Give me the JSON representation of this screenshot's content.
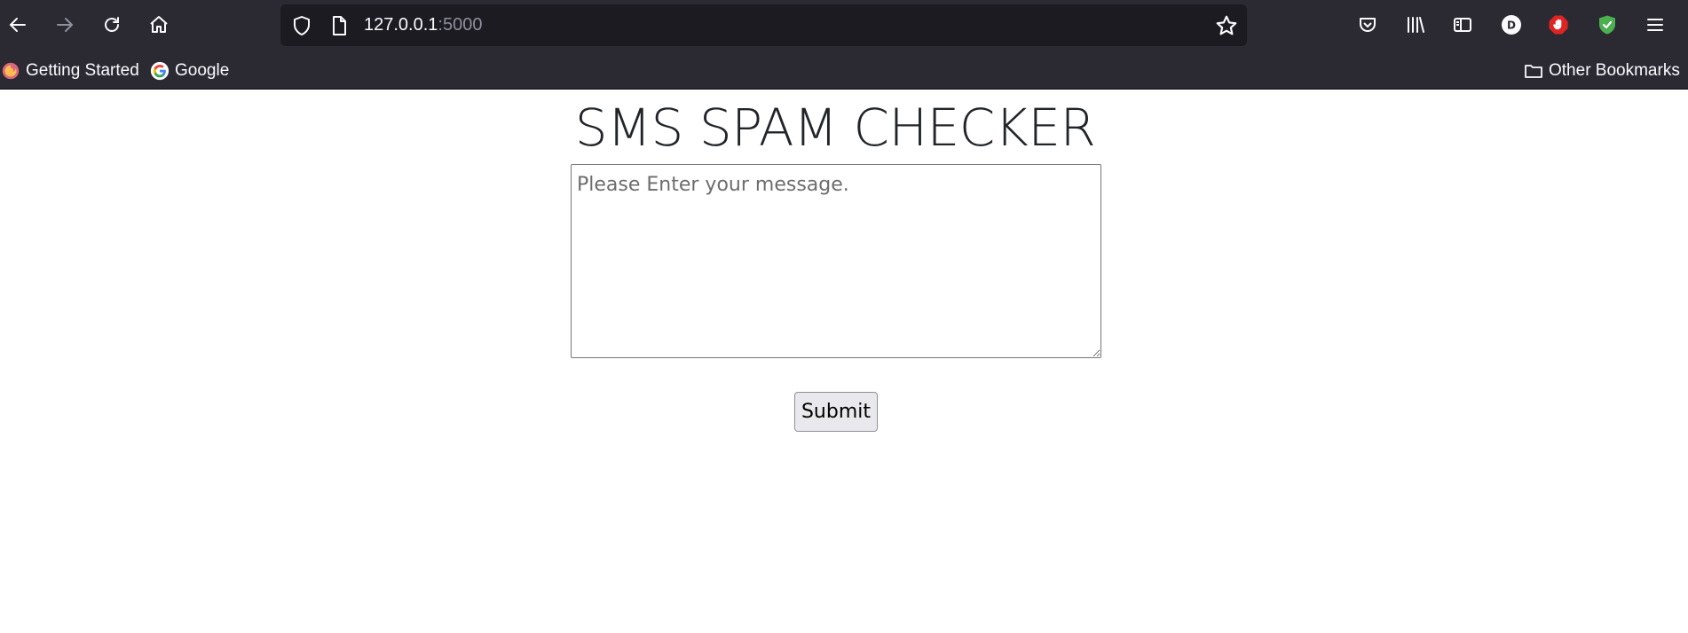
{
  "browser": {
    "url_host": "127.0.0.1",
    "url_port": ":5000",
    "nav_icons": [
      "back-icon",
      "forward-icon",
      "reload-icon",
      "home-icon"
    ],
    "toolbar_icons": [
      "pocket-icon",
      "library-icon",
      "sidebar-icon",
      "account-icon",
      "adblock-icon",
      "shield-extension-icon",
      "menu-icon"
    ],
    "account_initial": "D",
    "bookmarks": [
      {
        "label": "Getting Started",
        "icon": "firefox-icon"
      },
      {
        "label": "Google",
        "icon": "google-icon"
      }
    ],
    "other_bookmarks": "Other Bookmarks",
    "colors": {
      "chrome_bg": "#2b2a33",
      "urlbar_bg": "#1c1b22",
      "adblock": "#e02424",
      "shield_ext": "#4caf50"
    }
  },
  "page": {
    "title": "SMS SPAM CHECKER",
    "message_placeholder": "Please Enter your message.",
    "message_value": "",
    "submit_label": "Submit"
  }
}
